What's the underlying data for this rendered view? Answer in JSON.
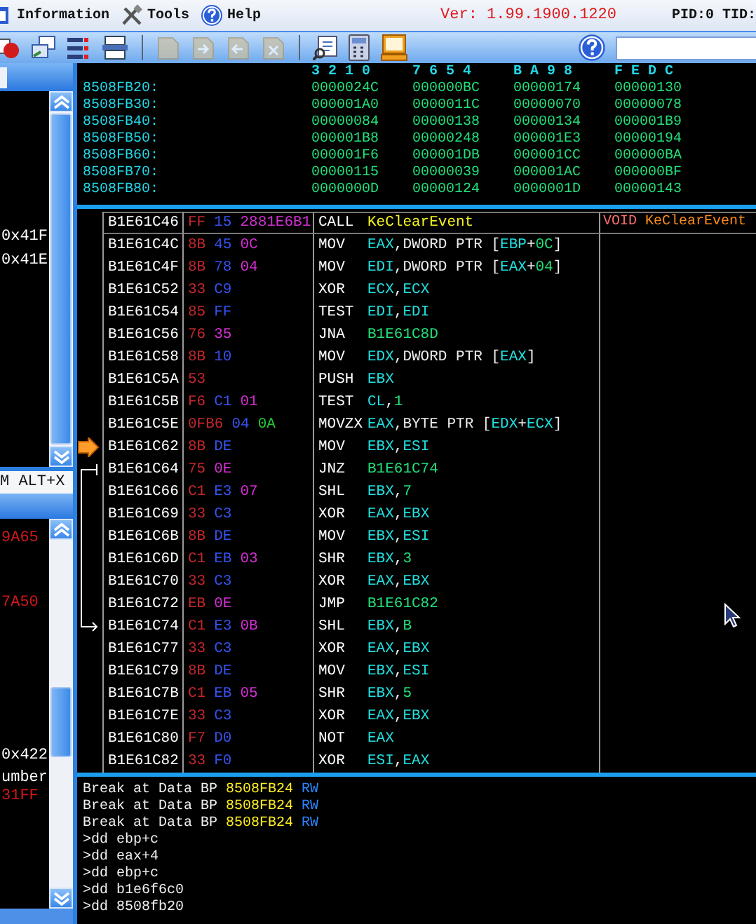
{
  "menu": {
    "items": [
      {
        "label": "Information"
      },
      {
        "label": "Tools"
      },
      {
        "label": "Help"
      }
    ],
    "version": "Ver: 1.99.1900.1220",
    "ids": "PID:0 TID:"
  },
  "toolbar": {
    "buttons": [
      {
        "kind": "record",
        "disabled": false
      },
      {
        "kind": "windows",
        "disabled": false
      },
      {
        "kind": "list",
        "disabled": false
      },
      {
        "kind": "printer",
        "disabled": false
      },
      {
        "kind": "page",
        "disabled": true
      },
      {
        "kind": "page-forward",
        "disabled": true
      },
      {
        "kind": "page-back",
        "disabled": true
      },
      {
        "kind": "page-delete",
        "disabled": true
      },
      {
        "kind": "document",
        "disabled": false
      },
      {
        "kind": "calculator",
        "disabled": false
      },
      {
        "kind": "monitor",
        "disabled": false
      }
    ]
  },
  "left_panel": {
    "upper_lines": [
      {
        "text": "0x41F",
        "color": "#ffffff"
      },
      {
        "text": "0x41E",
        "color": "#ffffff"
      }
    ],
    "hotkey": "M ALT+X",
    "lower_lines": [
      {
        "text": "9A65",
        "color": "#d01818"
      },
      {
        "text": "7A50",
        "color": "#d01818"
      },
      {
        "text": "0x422",
        "color": "#ffffff"
      },
      {
        "text": "umber",
        "color": "#ffffff"
      },
      {
        "text": "31FF",
        "color": "#d01818"
      }
    ]
  },
  "memory": {
    "columns": [
      "3 2 1 0",
      "7 6 5 4",
      "B A 9 8",
      "F E D C"
    ],
    "rows": [
      {
        "address": "8508FB20:",
        "values": [
          "0000024C",
          "000000BC",
          "00000174",
          "00000130"
        ]
      },
      {
        "address": "8508FB30:",
        "values": [
          "000001A0",
          "0000011C",
          "00000070",
          "00000078"
        ]
      },
      {
        "address": "8508FB40:",
        "values": [
          "00000084",
          "00000138",
          "00000134",
          "000001B9"
        ]
      },
      {
        "address": "8508FB50:",
        "values": [
          "000001B8",
          "00000248",
          "000001E3",
          "00000194"
        ]
      },
      {
        "address": "8508FB60:",
        "values": [
          "000001F6",
          "000001DB",
          "000001CC",
          "000000BA"
        ]
      },
      {
        "address": "8508FB70:",
        "values": [
          "00000115",
          "00000039",
          "000001AC",
          "000000BF"
        ]
      },
      {
        "address": "8508FB80:",
        "values": [
          "0000000D",
          "00000124",
          "0000001D",
          "00000143"
        ]
      }
    ]
  },
  "disassembly": {
    "rows": [
      {
        "address": "B1E61C46",
        "bytes": [
          {
            "text": "FF",
            "kind": "op"
          },
          {
            "text": "15",
            "kind": "mod"
          },
          {
            "text": "2881E6B1",
            "kind": "imm"
          }
        ],
        "mnemonic": "CALL",
        "operands": [
          {
            "text": "KeClearEvent",
            "kind": "sym"
          }
        ],
        "comment": [
          {
            "text": "VOID",
            "kind": "type"
          },
          {
            "text": "KeClearEvent",
            "kind": "func"
          }
        ],
        "selected": true,
        "current": false,
        "jump_from": false,
        "jump_to": false
      },
      {
        "address": "B1E61C4C",
        "bytes": [
          {
            "text": "8B",
            "kind": "op"
          },
          {
            "text": "45",
            "kind": "mod"
          },
          {
            "text": "0C",
            "kind": "imm"
          }
        ],
        "mnemonic": "MOV",
        "operands": [
          {
            "text": "EAX",
            "kind": "reg"
          },
          {
            "text": ",DWORD PTR [",
            "kind": "plain"
          },
          {
            "text": "EBP",
            "kind": "reg"
          },
          {
            "text": "+",
            "kind": "plain"
          },
          {
            "text": "0C",
            "kind": "num"
          },
          {
            "text": "]",
            "kind": "plain"
          }
        ],
        "selected": false,
        "current": false,
        "jump_from": false,
        "jump_to": false
      },
      {
        "address": "B1E61C4F",
        "bytes": [
          {
            "text": "8B",
            "kind": "op"
          },
          {
            "text": "78",
            "kind": "mod"
          },
          {
            "text": "04",
            "kind": "imm"
          }
        ],
        "mnemonic": "MOV",
        "operands": [
          {
            "text": "EDI",
            "kind": "reg"
          },
          {
            "text": ",DWORD PTR [",
            "kind": "plain"
          },
          {
            "text": "EAX",
            "kind": "reg"
          },
          {
            "text": "+",
            "kind": "plain"
          },
          {
            "text": "04",
            "kind": "num"
          },
          {
            "text": "]",
            "kind": "plain"
          }
        ],
        "selected": false,
        "current": false,
        "jump_from": false,
        "jump_to": false
      },
      {
        "address": "B1E61C52",
        "bytes": [
          {
            "text": "33",
            "kind": "op"
          },
          {
            "text": "C9",
            "kind": "mod"
          }
        ],
        "mnemonic": "XOR",
        "operands": [
          {
            "text": "ECX",
            "kind": "reg"
          },
          {
            "text": ",",
            "kind": "plain"
          },
          {
            "text": "ECX",
            "kind": "reg"
          }
        ],
        "selected": false,
        "current": false,
        "jump_from": false,
        "jump_to": false
      },
      {
        "address": "B1E61C54",
        "bytes": [
          {
            "text": "85",
            "kind": "op"
          },
          {
            "text": "FF",
            "kind": "mod"
          }
        ],
        "mnemonic": "TEST",
        "operands": [
          {
            "text": "EDI",
            "kind": "reg"
          },
          {
            "text": ",",
            "kind": "plain"
          },
          {
            "text": "EDI",
            "kind": "reg"
          }
        ],
        "selected": false,
        "current": false,
        "jump_from": false,
        "jump_to": false
      },
      {
        "address": "B1E61C56",
        "bytes": [
          {
            "text": "76",
            "kind": "op"
          },
          {
            "text": "35",
            "kind": "imm"
          }
        ],
        "mnemonic": "JNA",
        "operands": [
          {
            "text": "B1E61C8D",
            "kind": "num"
          }
        ],
        "selected": false,
        "current": false,
        "jump_from": false,
        "jump_to": false
      },
      {
        "address": "B1E61C58",
        "bytes": [
          {
            "text": "8B",
            "kind": "op"
          },
          {
            "text": "10",
            "kind": "mod"
          }
        ],
        "mnemonic": "MOV",
        "operands": [
          {
            "text": "EDX",
            "kind": "reg"
          },
          {
            "text": ",DWORD PTR [",
            "kind": "plain"
          },
          {
            "text": "EAX",
            "kind": "reg"
          },
          {
            "text": "]",
            "kind": "plain"
          }
        ],
        "selected": false,
        "current": false,
        "jump_from": false,
        "jump_to": false
      },
      {
        "address": "B1E61C5A",
        "bytes": [
          {
            "text": "53",
            "kind": "op"
          }
        ],
        "mnemonic": "PUSH",
        "operands": [
          {
            "text": "EBX",
            "kind": "reg"
          }
        ],
        "selected": false,
        "current": false,
        "jump_from": false,
        "jump_to": false
      },
      {
        "address": "B1E61C5B",
        "bytes": [
          {
            "text": "F6",
            "kind": "op"
          },
          {
            "text": "C1",
            "kind": "mod"
          },
          {
            "text": "01",
            "kind": "imm"
          }
        ],
        "mnemonic": "TEST",
        "operands": [
          {
            "text": "CL",
            "kind": "reg"
          },
          {
            "text": ",",
            "kind": "plain"
          },
          {
            "text": "1",
            "kind": "num"
          }
        ],
        "selected": false,
        "current": false,
        "jump_from": false,
        "jump_to": false
      },
      {
        "address": "B1E61C5E",
        "bytes": [
          {
            "text": "0FB6",
            "kind": "op"
          },
          {
            "text": "04",
            "kind": "mod"
          },
          {
            "text": "0A",
            "kind": "sib"
          }
        ],
        "mnemonic": "MOVZX",
        "operands": [
          {
            "text": "EAX",
            "kind": "reg"
          },
          {
            "text": ",BYTE PTR [",
            "kind": "plain"
          },
          {
            "text": "EDX",
            "kind": "reg"
          },
          {
            "text": "+",
            "kind": "plain"
          },
          {
            "text": "ECX",
            "kind": "reg"
          },
          {
            "text": "]",
            "kind": "plain"
          }
        ],
        "selected": false,
        "current": false,
        "jump_from": false,
        "jump_to": false
      },
      {
        "address": "B1E61C62",
        "bytes": [
          {
            "text": "8B",
            "kind": "op"
          },
          {
            "text": "DE",
            "kind": "mod"
          }
        ],
        "mnemonic": "MOV",
        "operands": [
          {
            "text": "EBX",
            "kind": "reg"
          },
          {
            "text": ",",
            "kind": "plain"
          },
          {
            "text": "ESI",
            "kind": "reg"
          }
        ],
        "selected": false,
        "current": true,
        "jump_from": false,
        "jump_to": false
      },
      {
        "address": "B1E61C64",
        "bytes": [
          {
            "text": "75",
            "kind": "op"
          },
          {
            "text": "0E",
            "kind": "imm"
          }
        ],
        "mnemonic": "JNZ",
        "operands": [
          {
            "text": "B1E61C74",
            "kind": "num"
          }
        ],
        "selected": false,
        "current": false,
        "jump_from": true,
        "jump_to": false
      },
      {
        "address": "B1E61C66",
        "bytes": [
          {
            "text": "C1",
            "kind": "op"
          },
          {
            "text": "E3",
            "kind": "mod"
          },
          {
            "text": "07",
            "kind": "imm"
          }
        ],
        "mnemonic": "SHL",
        "operands": [
          {
            "text": "EBX",
            "kind": "reg"
          },
          {
            "text": ",",
            "kind": "plain"
          },
          {
            "text": "7",
            "kind": "num"
          }
        ],
        "selected": false,
        "current": false,
        "jump_from": false,
        "jump_to": false
      },
      {
        "address": "B1E61C69",
        "bytes": [
          {
            "text": "33",
            "kind": "op"
          },
          {
            "text": "C3",
            "kind": "mod"
          }
        ],
        "mnemonic": "XOR",
        "operands": [
          {
            "text": "EAX",
            "kind": "reg"
          },
          {
            "text": ",",
            "kind": "plain"
          },
          {
            "text": "EBX",
            "kind": "reg"
          }
        ],
        "selected": false,
        "current": false,
        "jump_from": false,
        "jump_to": false
      },
      {
        "address": "B1E61C6B",
        "bytes": [
          {
            "text": "8B",
            "kind": "op"
          },
          {
            "text": "DE",
            "kind": "mod"
          }
        ],
        "mnemonic": "MOV",
        "operands": [
          {
            "text": "EBX",
            "kind": "reg"
          },
          {
            "text": ",",
            "kind": "plain"
          },
          {
            "text": "ESI",
            "kind": "reg"
          }
        ],
        "selected": false,
        "current": false,
        "jump_from": false,
        "jump_to": false
      },
      {
        "address": "B1E61C6D",
        "bytes": [
          {
            "text": "C1",
            "kind": "op"
          },
          {
            "text": "EB",
            "kind": "mod"
          },
          {
            "text": "03",
            "kind": "imm"
          }
        ],
        "mnemonic": "SHR",
        "operands": [
          {
            "text": "EBX",
            "kind": "reg"
          },
          {
            "text": ",",
            "kind": "plain"
          },
          {
            "text": "3",
            "kind": "num"
          }
        ],
        "selected": false,
        "current": false,
        "jump_from": false,
        "jump_to": false
      },
      {
        "address": "B1E61C70",
        "bytes": [
          {
            "text": "33",
            "kind": "op"
          },
          {
            "text": "C3",
            "kind": "mod"
          }
        ],
        "mnemonic": "XOR",
        "operands": [
          {
            "text": "EAX",
            "kind": "reg"
          },
          {
            "text": ",",
            "kind": "plain"
          },
          {
            "text": "EBX",
            "kind": "reg"
          }
        ],
        "selected": false,
        "current": false,
        "jump_from": false,
        "jump_to": false
      },
      {
        "address": "B1E61C72",
        "bytes": [
          {
            "text": "EB",
            "kind": "op"
          },
          {
            "text": "0E",
            "kind": "imm"
          }
        ],
        "mnemonic": "JMP",
        "operands": [
          {
            "text": "B1E61C82",
            "kind": "num"
          }
        ],
        "selected": false,
        "current": false,
        "jump_from": false,
        "jump_to": false
      },
      {
        "address": "B1E61C74",
        "bytes": [
          {
            "text": "C1",
            "kind": "op"
          },
          {
            "text": "E3",
            "kind": "mod"
          },
          {
            "text": "0B",
            "kind": "imm"
          }
        ],
        "mnemonic": "SHL",
        "operands": [
          {
            "text": "EBX",
            "kind": "reg"
          },
          {
            "text": ",",
            "kind": "plain"
          },
          {
            "text": "B",
            "kind": "num"
          }
        ],
        "selected": false,
        "current": false,
        "jump_from": false,
        "jump_to": true
      },
      {
        "address": "B1E61C77",
        "bytes": [
          {
            "text": "33",
            "kind": "op"
          },
          {
            "text": "C3",
            "kind": "mod"
          }
        ],
        "mnemonic": "XOR",
        "operands": [
          {
            "text": "EAX",
            "kind": "reg"
          },
          {
            "text": ",",
            "kind": "plain"
          },
          {
            "text": "EBX",
            "kind": "reg"
          }
        ],
        "selected": false,
        "current": false,
        "jump_from": false,
        "jump_to": false
      },
      {
        "address": "B1E61C79",
        "bytes": [
          {
            "text": "8B",
            "kind": "op"
          },
          {
            "text": "DE",
            "kind": "mod"
          }
        ],
        "mnemonic": "MOV",
        "operands": [
          {
            "text": "EBX",
            "kind": "reg"
          },
          {
            "text": ",",
            "kind": "plain"
          },
          {
            "text": "ESI",
            "kind": "reg"
          }
        ],
        "selected": false,
        "current": false,
        "jump_from": false,
        "jump_to": false
      },
      {
        "address": "B1E61C7B",
        "bytes": [
          {
            "text": "C1",
            "kind": "op"
          },
          {
            "text": "EB",
            "kind": "mod"
          },
          {
            "text": "05",
            "kind": "imm"
          }
        ],
        "mnemonic": "SHR",
        "operands": [
          {
            "text": "EBX",
            "kind": "reg"
          },
          {
            "text": ",",
            "kind": "plain"
          },
          {
            "text": "5",
            "kind": "num"
          }
        ],
        "selected": false,
        "current": false,
        "jump_from": false,
        "jump_to": false
      },
      {
        "address": "B1E61C7E",
        "bytes": [
          {
            "text": "33",
            "kind": "op"
          },
          {
            "text": "C3",
            "kind": "mod"
          }
        ],
        "mnemonic": "XOR",
        "operands": [
          {
            "text": "EAX",
            "kind": "reg"
          },
          {
            "text": ",",
            "kind": "plain"
          },
          {
            "text": "EBX",
            "kind": "reg"
          }
        ],
        "selected": false,
        "current": false,
        "jump_from": false,
        "jump_to": false
      },
      {
        "address": "B1E61C80",
        "bytes": [
          {
            "text": "F7",
            "kind": "op"
          },
          {
            "text": "D0",
            "kind": "mod"
          }
        ],
        "mnemonic": "NOT",
        "operands": [
          {
            "text": "EAX",
            "kind": "reg"
          }
        ],
        "selected": false,
        "current": false,
        "jump_from": false,
        "jump_to": false
      },
      {
        "address": "B1E61C82",
        "bytes": [
          {
            "text": "33",
            "kind": "op"
          },
          {
            "text": "F0",
            "kind": "mod"
          }
        ],
        "mnemonic": "XOR",
        "operands": [
          {
            "text": "ESI",
            "kind": "reg"
          },
          {
            "text": ",",
            "kind": "plain"
          },
          {
            "text": "EAX",
            "kind": "reg"
          }
        ],
        "selected": false,
        "current": false,
        "jump_from": false,
        "jump_to": false
      }
    ]
  },
  "console": {
    "lines": [
      [
        {
          "text": "Break at Data BP ",
          "kind": "plain"
        },
        {
          "text": "8508FB24",
          "kind": "addr"
        },
        {
          "text": " RW",
          "kind": "flag"
        }
      ],
      [
        {
          "text": "Break at Data BP ",
          "kind": "plain"
        },
        {
          "text": "8508FB24",
          "kind": "addr"
        },
        {
          "text": " RW",
          "kind": "flag"
        }
      ],
      [
        {
          "text": "Break at Data BP ",
          "kind": "plain"
        },
        {
          "text": "8508FB24",
          "kind": "addr"
        },
        {
          "text": " RW",
          "kind": "flag"
        }
      ],
      [
        {
          "text": ">dd ebp+c",
          "kind": "plain"
        }
      ],
      [
        {
          "text": ">dd eax+4",
          "kind": "plain"
        }
      ],
      [
        {
          "text": ">dd ebp+c",
          "kind": "plain"
        }
      ],
      [
        {
          "text": ">dd b1e6f6c0",
          "kind": "plain"
        }
      ],
      [
        {
          "text": ">dd 8508fb20",
          "kind": "plain"
        }
      ]
    ]
  }
}
